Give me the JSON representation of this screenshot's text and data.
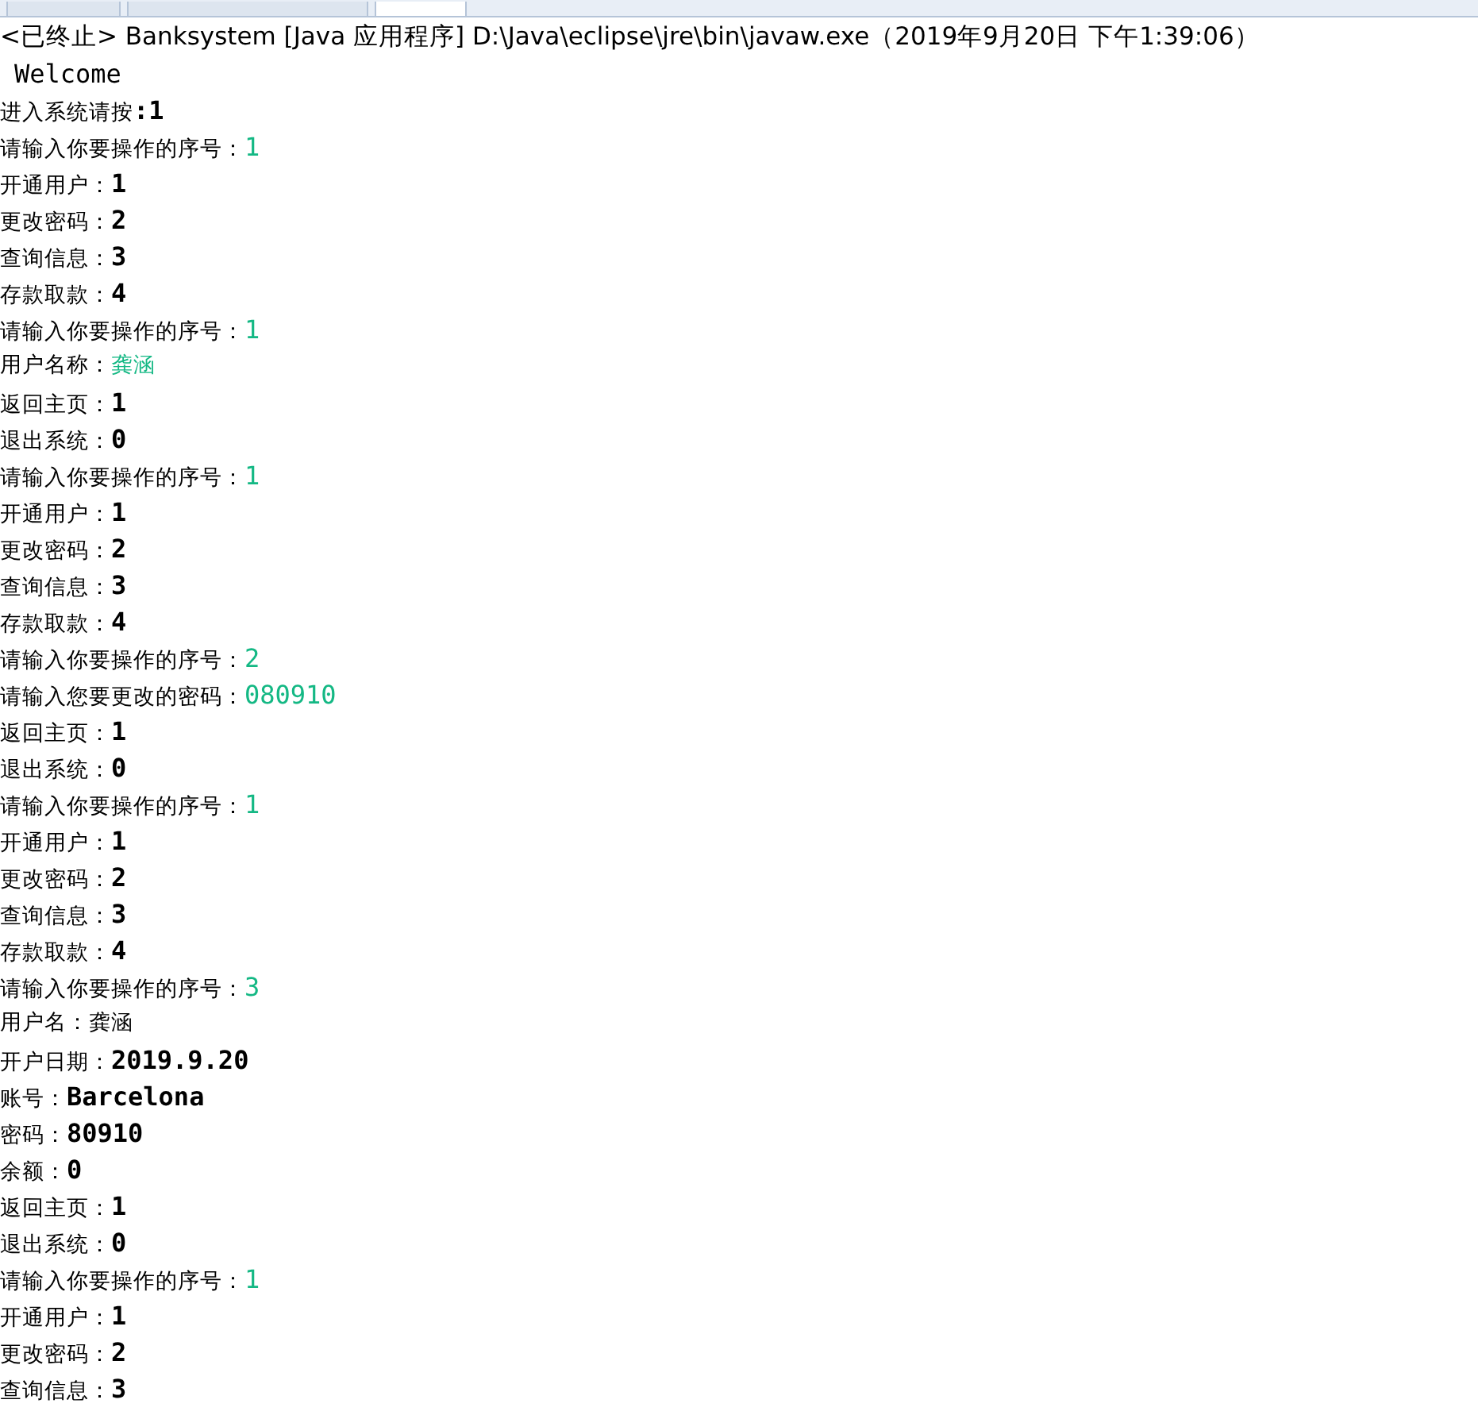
{
  "console_title": "<已终止> Banksystem [Java 应用程序] D:\\Java\\eclipse\\jre\\bin\\javaw.exe（2019年9月20日 下午1:39:06）",
  "tabs": [
    {
      "selected": false
    },
    {
      "selected": false
    },
    {
      "selected": true
    }
  ],
  "lines": [
    {
      "text": "Welcome"
    },
    {
      "text": "进入系统请按",
      "tail": ":1"
    },
    {
      "text": "请输入你要操作的序号：",
      "input": "1"
    },
    {
      "text": "开通用户：",
      "tail": "1"
    },
    {
      "text": "更改密码：",
      "tail": "2"
    },
    {
      "text": "查询信息：",
      "tail": "3"
    },
    {
      "text": "存款取款：",
      "tail": "4"
    },
    {
      "text": "请输入你要操作的序号：",
      "input": "1"
    },
    {
      "text": "用户名称：",
      "input": "龚涵"
    },
    {
      "text": "返回主页：",
      "tail": "1"
    },
    {
      "text": "退出系统：",
      "tail": "0"
    },
    {
      "text": "请输入你要操作的序号：",
      "input": "1"
    },
    {
      "text": "开通用户：",
      "tail": "1"
    },
    {
      "text": "更改密码：",
      "tail": "2"
    },
    {
      "text": "查询信息：",
      "tail": "3"
    },
    {
      "text": "存款取款：",
      "tail": "4"
    },
    {
      "text": "请输入你要操作的序号：",
      "input": "2"
    },
    {
      "text": "请输入您要更改的密码：",
      "input": "080910"
    },
    {
      "text": "返回主页：",
      "tail": "1"
    },
    {
      "text": "退出系统：",
      "tail": "0"
    },
    {
      "text": "请输入你要操作的序号：",
      "input": "1"
    },
    {
      "text": "开通用户：",
      "tail": "1"
    },
    {
      "text": "更改密码：",
      "tail": "2"
    },
    {
      "text": "查询信息：",
      "tail": "3"
    },
    {
      "text": "存款取款：",
      "tail": "4"
    },
    {
      "text": "请输入你要操作的序号：",
      "input": "3"
    },
    {
      "text": "用户名：龚涵"
    },
    {
      "text": "开户日期：",
      "tail": "2019.9.20"
    },
    {
      "text": "账号：",
      "tail": "Barcelona"
    },
    {
      "text": "密码：",
      "tail": "80910"
    },
    {
      "text": "余额：",
      "tail": "0"
    },
    {
      "text": "返回主页：",
      "tail": "1"
    },
    {
      "text": "退出系统：",
      "tail": "0"
    },
    {
      "text": "请输入你要操作的序号：",
      "input": "1"
    },
    {
      "text": "开通用户：",
      "tail": "1"
    },
    {
      "text": "更改密码：",
      "tail": "2"
    },
    {
      "text": "查询信息：",
      "tail": "3"
    }
  ]
}
